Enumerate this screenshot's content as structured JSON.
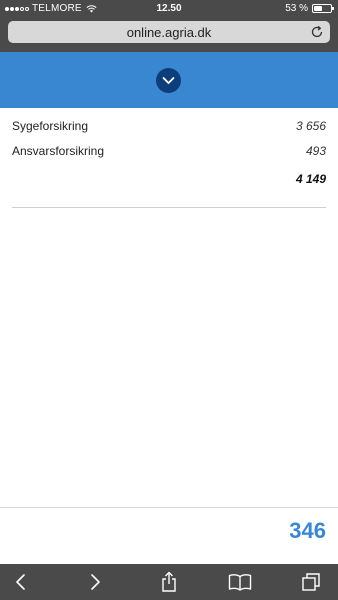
{
  "status_bar": {
    "carrier": "TELMORE",
    "time": "12.50",
    "battery_text": "53 %",
    "battery_level": 0.53
  },
  "browser": {
    "url": "online.agria.dk"
  },
  "rows": [
    {
      "label": "Sygeforsikring",
      "value": "3 656"
    },
    {
      "label": "Ansvarsforsikring",
      "value": "493"
    }
  ],
  "total": "4 149",
  "footer": {
    "amount": "346"
  },
  "icons": {
    "expand": "chevron-down-icon",
    "reload": "reload-icon",
    "back": "back-icon",
    "forward": "forward-icon",
    "share": "share-icon",
    "bookmarks": "bookmarks-icon",
    "tabs": "tabs-icon"
  },
  "colors": {
    "banner": "#3a87d1",
    "expand_button": "#0d3d7a",
    "accent_amount": "#3a87d1",
    "chrome": "#4a4a4a"
  }
}
